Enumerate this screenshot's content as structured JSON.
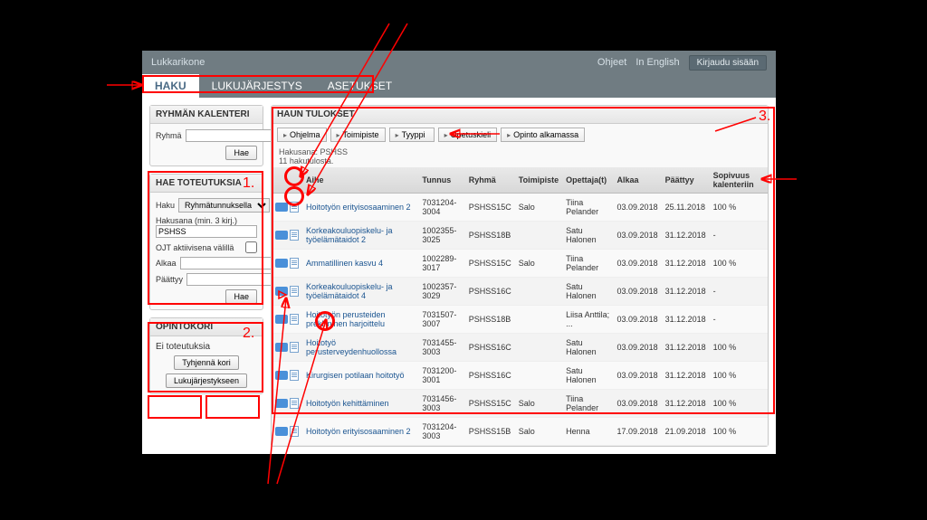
{
  "app_title": "Lukkarikone",
  "top_links": {
    "help": "Ohjeet",
    "lang": "In English",
    "login": "Kirjaudu sisään"
  },
  "tabs": {
    "search": "HAKU",
    "timetable": "LUKUJÄRJESTYS",
    "settings": "ASETUKSET"
  },
  "group_cal": {
    "title": "RYHMÄN KALENTERI",
    "group_label": "Ryhmä",
    "search_btn": "Hae"
  },
  "search_panel": {
    "title": "HAE TOTEUTUKSIA",
    "haku_label": "Haku",
    "haku_select": "Ryhmätunnuksella",
    "hakusana_label": "Hakusana (min. 3 kirj.)",
    "hakusana_value": "PSHSS",
    "ojt_label": "OJT aktiivisena välillä",
    "alkaa_label": "Alkaa",
    "paattyy_label": "Päättyy",
    "search_btn": "Hae"
  },
  "basket": {
    "title": "OPINTOKORI",
    "empty": "Ei toteutuksia",
    "clear_btn": "Tyhjennä kori",
    "to_tt_btn": "Lukujärjestykseen"
  },
  "results": {
    "title": "HAUN TULOKSET",
    "filters": [
      "Ohjelma",
      "Toimipiste",
      "Tyyppi",
      "Opetuskieli",
      "Opinto alkamassa"
    ],
    "info_line1": "Hakusana: PSHSS",
    "info_line2": "11 hakutulosta.",
    "columns": {
      "aihe": "Aihe",
      "tunnus": "Tunnus",
      "ryhma": "Ryhmä",
      "toimipiste": "Toimipiste",
      "opettajat": "Opettaja(t)",
      "alkaa": "Alkaa",
      "paattyy": "Päättyy",
      "sopivuus": "Sopivuus kalenteriin"
    },
    "rows": [
      {
        "aihe": "Hoitotyön erityisosaaminen 2",
        "tunnus": "7031204-3004",
        "ryhma": "PSHSS15C",
        "toimi": "Salo",
        "ope": "Tiina Pelander",
        "alkaa": "03.09.2018",
        "paattyy": "25.11.2018",
        "sop": "100 %"
      },
      {
        "aihe": "Korkeakouluopiskelu- ja työelämätaidot 2",
        "tunnus": "1002355-3025",
        "ryhma": "PSHSS18B",
        "toimi": "",
        "ope": "Satu Halonen",
        "alkaa": "03.09.2018",
        "paattyy": "31.12.2018",
        "sop": "-"
      },
      {
        "aihe": "Ammatillinen kasvu 4",
        "tunnus": "1002289-3017",
        "ryhma": "PSHSS15C",
        "toimi": "Salo",
        "ope": "Tiina Pelander",
        "alkaa": "03.09.2018",
        "paattyy": "31.12.2018",
        "sop": "100 %"
      },
      {
        "aihe": "Korkeakouluopiskelu- ja työelämätaidot 4",
        "tunnus": "1002357-3029",
        "ryhma": "PSHSS16C",
        "toimi": "",
        "ope": "Satu Halonen",
        "alkaa": "03.09.2018",
        "paattyy": "31.12.2018",
        "sop": "-"
      },
      {
        "aihe": "Hoitotyön perusteiden prekliininen harjoittelu",
        "tunnus": "7031507-3007",
        "ryhma": "PSHSS18B",
        "toimi": "",
        "ope": "Liisa Anttila; ...",
        "alkaa": "03.09.2018",
        "paattyy": "31.12.2018",
        "sop": "-"
      },
      {
        "aihe": "Hoitotyö perusterveydenhuollossa",
        "tunnus": "7031455-3003",
        "ryhma": "PSHSS16C",
        "toimi": "",
        "ope": "Satu Halonen",
        "alkaa": "03.09.2018",
        "paattyy": "31.12.2018",
        "sop": "100 %"
      },
      {
        "aihe": "Kirurgisen potilaan hoitotyö",
        "tunnus": "7031200-3001",
        "ryhma": "PSHSS16C",
        "toimi": "",
        "ope": "Satu Halonen",
        "alkaa": "03.09.2018",
        "paattyy": "31.12.2018",
        "sop": "100 %"
      },
      {
        "aihe": "Hoitotyön kehittäminen",
        "tunnus": "7031456-3003",
        "ryhma": "PSHSS15C",
        "toimi": "Salo",
        "ope": "Tiina Pelander",
        "alkaa": "03.09.2018",
        "paattyy": "31.12.2018",
        "sop": "100 %"
      },
      {
        "aihe": "Hoitotyön erityisosaaminen 2",
        "tunnus": "7031204-3003",
        "ryhma": "PSHSS15B",
        "toimi": "Salo",
        "ope": "Henna",
        "alkaa": "17.09.2018",
        "paattyy": "21.09.2018",
        "sop": "100 %"
      }
    ]
  },
  "annotations": {
    "n1": "1.",
    "n2": "2.",
    "n3": "3."
  }
}
